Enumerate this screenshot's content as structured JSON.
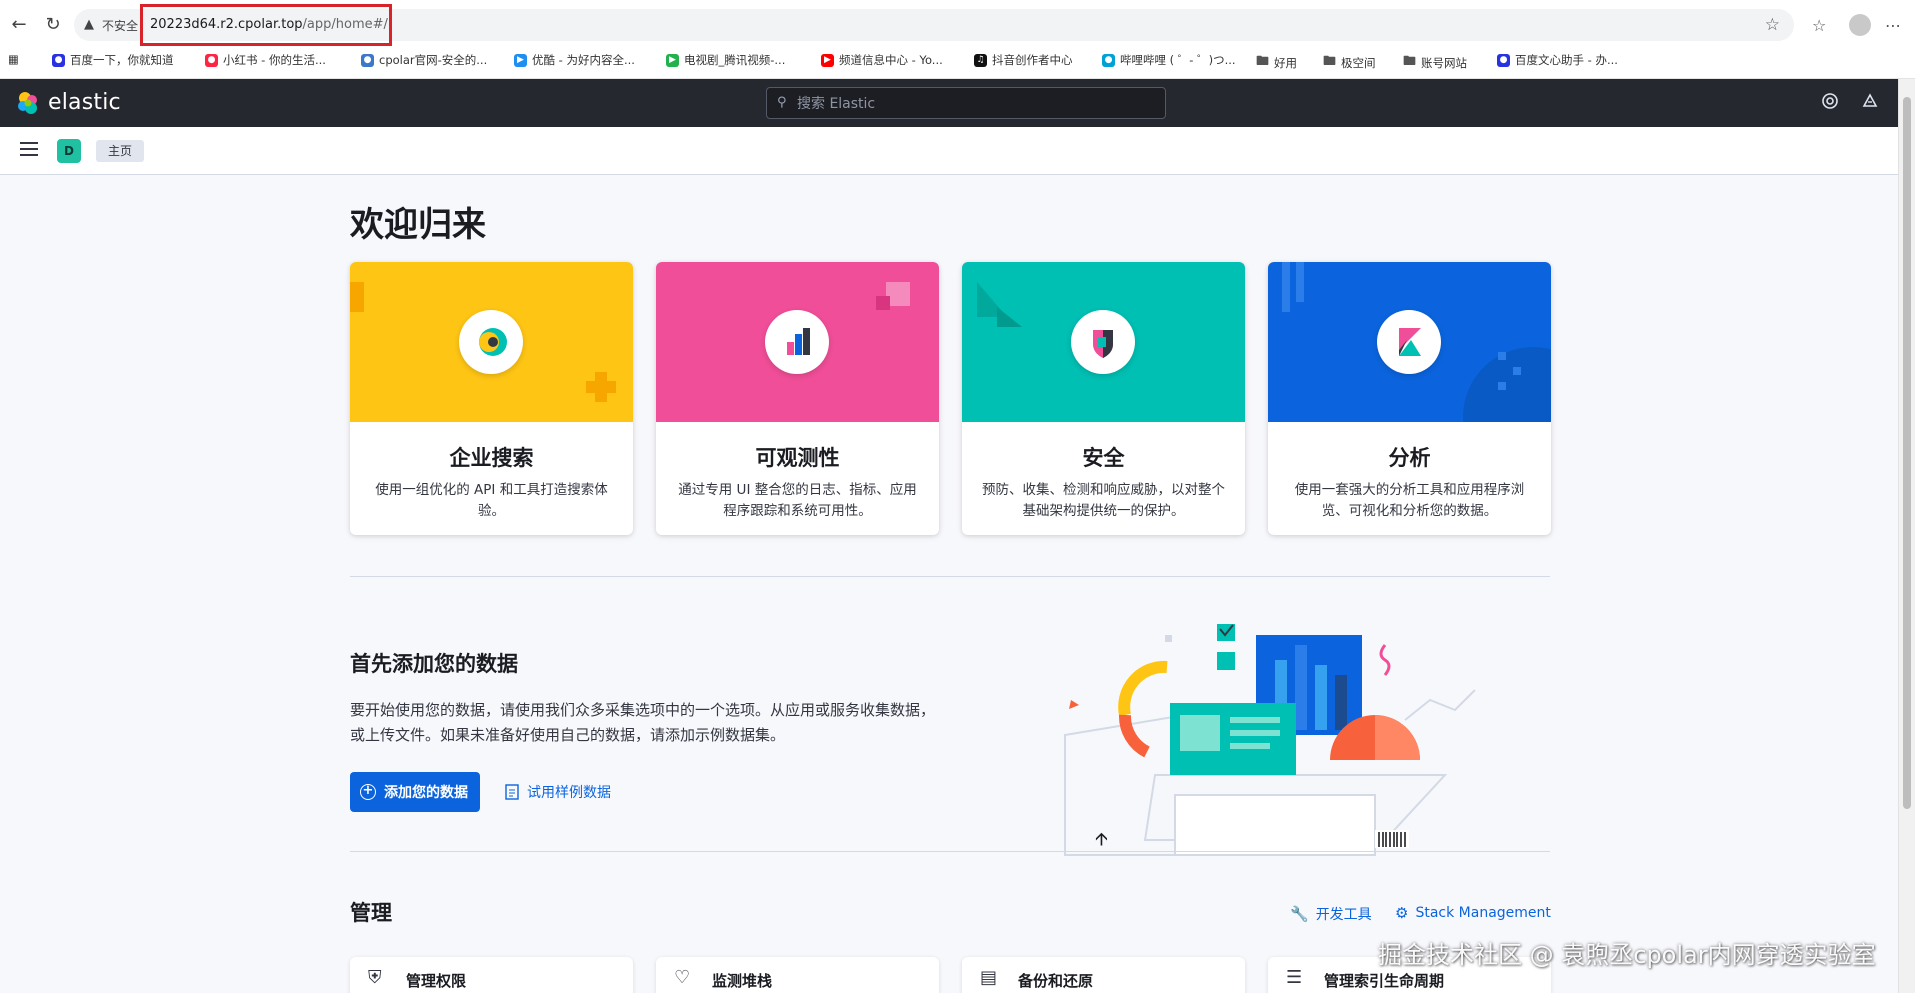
{
  "browser": {
    "insecure_label": "不安全",
    "url_host": "20223d64.r2.cpolar.top",
    "url_path": "/app/home#/",
    "bookmarks": [
      {
        "label": "百度一下，你就知道",
        "icon": "baidu-icon",
        "color": "#2932e1"
      },
      {
        "label": "小红书 - 你的生活...",
        "icon": "xiaohongshu-icon",
        "color": "#ff2442"
      },
      {
        "label": "cpolar官网-安全的...",
        "icon": "cpolar-icon",
        "color": "#3a78c9"
      },
      {
        "label": "优酷 - 为好内容全...",
        "icon": "youku-icon",
        "color": "#1f8ef1"
      },
      {
        "label": "电视剧_腾讯视频-...",
        "icon": "tencent-video-icon",
        "color": "#22b14c"
      },
      {
        "label": "频道信息中心 - Yo...",
        "icon": "youtube-icon",
        "color": "#ff0000"
      },
      {
        "label": "抖音创作者中心",
        "icon": "douyin-icon",
        "color": "#111111"
      },
      {
        "label": "哔哩哔哩 ( ゜- ゜)つ...",
        "icon": "bilibili-icon",
        "color": "#00a1d6"
      },
      {
        "label": "好用",
        "icon": "folder-icon",
        "color": "#666666"
      },
      {
        "label": "极空间",
        "icon": "folder-icon",
        "color": "#666666"
      },
      {
        "label": "账号网站",
        "icon": "folder-icon",
        "color": "#666666"
      },
      {
        "label": "百度文心助手 - 办...",
        "icon": "baidu-icon",
        "color": "#2932e1"
      }
    ]
  },
  "header": {
    "logo_text": "elastic",
    "search_placeholder": "搜索 Elastic",
    "space_initial": "D",
    "breadcrumb": "主页"
  },
  "page": {
    "title": "欢迎归来",
    "solutions": [
      {
        "title": "企业搜索",
        "desc": "使用一组优化的 API 和工具打造搜索体验。",
        "color": "#fec514",
        "icon": "enterprise-search-icon"
      },
      {
        "title": "可观测性",
        "desc": "通过专用 UI 整合您的日志、指标、应用程序跟踪和系统可用性。",
        "color": "#f04e98",
        "icon": "observability-icon"
      },
      {
        "title": "安全",
        "desc": "预防、收集、检测和响应威胁，以对整个基础架构提供统一的保护。",
        "color": "#00bfb3",
        "icon": "security-icon"
      },
      {
        "title": "分析",
        "desc": "使用一套强大的分析工具和应用程序浏览、可视化和分析您的数据。",
        "color": "#0b64dd",
        "icon": "kibana-icon"
      }
    ],
    "add_data": {
      "title": "首先添加您的数据",
      "desc": "要开始使用您的数据，请使用我们众多采集选项中的一个选项。从应用或服务收集数据，或上传文件。如果未准备好使用自己的数据，请添加示例数据集。",
      "primary_button": "添加您的数据",
      "secondary_button": "试用样例数据"
    },
    "management": {
      "title": "管理",
      "dev_tools": "开发工具",
      "stack_management": "Stack Management",
      "cards": [
        {
          "label": "管理权限",
          "icon": "shield-icon"
        },
        {
          "label": "监测堆栈",
          "icon": "heartbeat-icon"
        },
        {
          "label": "备份和还原",
          "icon": "database-icon"
        },
        {
          "label": "管理索引生命周期",
          "icon": "document-icon"
        }
      ]
    }
  },
  "watermark": "掘金技术社区 @ 袁煦丞cpolar内网穿透实验室"
}
